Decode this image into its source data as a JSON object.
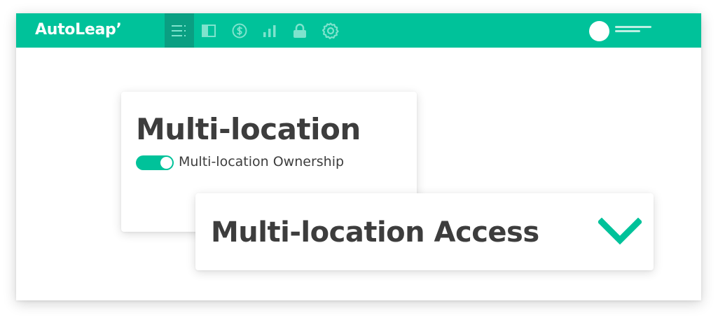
{
  "app": {
    "logo_text": "AutoLeap",
    "logo_mark": "’"
  },
  "nav": {
    "icons": [
      {
        "name": "menu-list-icon",
        "active": true
      },
      {
        "name": "panel-layout-icon",
        "active": false
      },
      {
        "name": "dollar-icon",
        "active": false
      },
      {
        "name": "bar-chart-icon",
        "active": false
      },
      {
        "name": "lock-icon",
        "active": false
      },
      {
        "name": "gear-icon",
        "active": false
      }
    ]
  },
  "user": {
    "avatar_icon": "user-avatar"
  },
  "settings_card": {
    "title": "Multi-location",
    "toggle_label": "Multi-location Ownership",
    "toggle_on": true
  },
  "access_card": {
    "title": "Multi-location Access",
    "indicator_icon": "chevron-down-icon"
  },
  "colors": {
    "brand": "#00c29a",
    "brand_dark": "#0a9f82",
    "icon_tint": "#7ee3cd",
    "text": "#3d3d3d",
    "white": "#ffffff"
  }
}
